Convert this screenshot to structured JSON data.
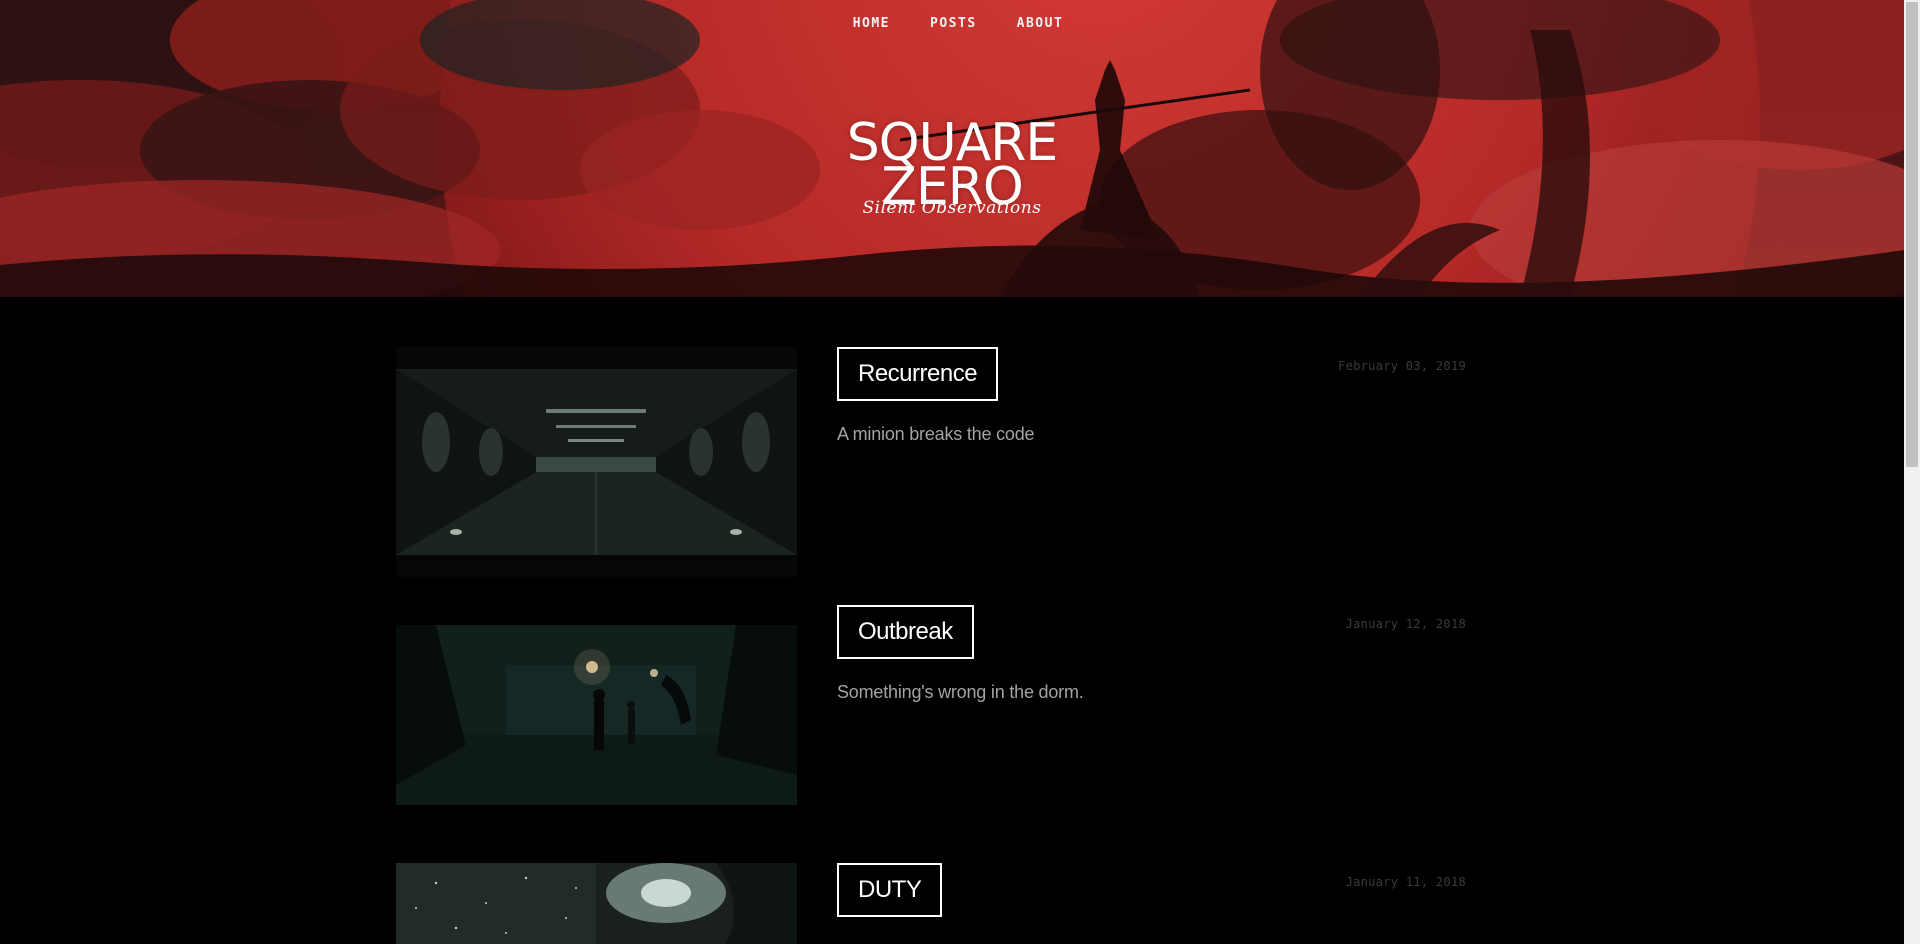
{
  "nav": {
    "items": [
      {
        "label": "HOME"
      },
      {
        "label": "POSTS"
      },
      {
        "label": "ABOUT"
      }
    ]
  },
  "site": {
    "title_line1": "SQUARE",
    "title_line2": "ZERO",
    "tagline": "Silent Observations"
  },
  "posts": [
    {
      "title": "Recurrence",
      "description": "A minion breaks the code",
      "date": "February 03, 2019"
    },
    {
      "title": "Outbreak",
      "description": "Something's wrong in the dorm.",
      "date": "January 12, 2018"
    },
    {
      "title": "DUTY",
      "description": "",
      "date": "January 11, 2018"
    }
  ],
  "colors": {
    "page_background": "#000000",
    "hero_red": "#b52626",
    "title_text": "#ffffff",
    "description_text": "#a3a3a3",
    "date_text": "#3b3b3b"
  }
}
